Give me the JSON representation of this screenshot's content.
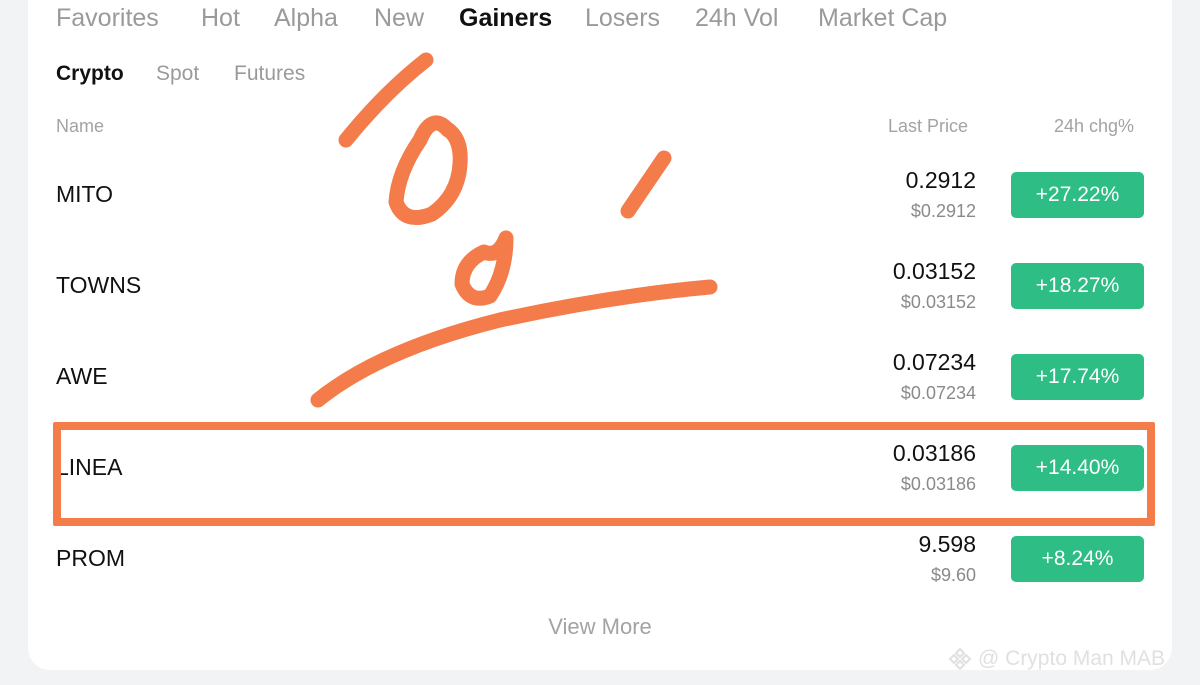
{
  "tabs": [
    "Favorites",
    "Hot",
    "Alpha",
    "New",
    "Gainers",
    "Losers",
    "24h Vol",
    "Market Cap"
  ],
  "active_tab": "Gainers",
  "subtabs": [
    "Crypto",
    "Spot",
    "Futures"
  ],
  "active_subtab": "Crypto",
  "columns": {
    "name": "Name",
    "last_price": "Last Price",
    "change": "24h chg%"
  },
  "rows": [
    {
      "name": "MITO",
      "price": "0.2912",
      "usd": "$0.2912",
      "change": "+27.22%"
    },
    {
      "name": "TOWNS",
      "price": "0.03152",
      "usd": "$0.03152",
      "change": "+18.27%"
    },
    {
      "name": "AWE",
      "price": "0.07234",
      "usd": "$0.07234",
      "change": "+17.74%"
    },
    {
      "name": "LINEA",
      "price": "0.03186",
      "usd": "$0.03186",
      "change": "+14.40%"
    },
    {
      "name": "PROM",
      "price": "9.598",
      "usd": "$9.60",
      "change": "+8.24%"
    }
  ],
  "view_more": "View More",
  "watermark": "@ Crypto Man MAB",
  "colors": {
    "gain": "#2ebd85",
    "annotation": "#f47b4a",
    "background": "#f2f3f5"
  }
}
